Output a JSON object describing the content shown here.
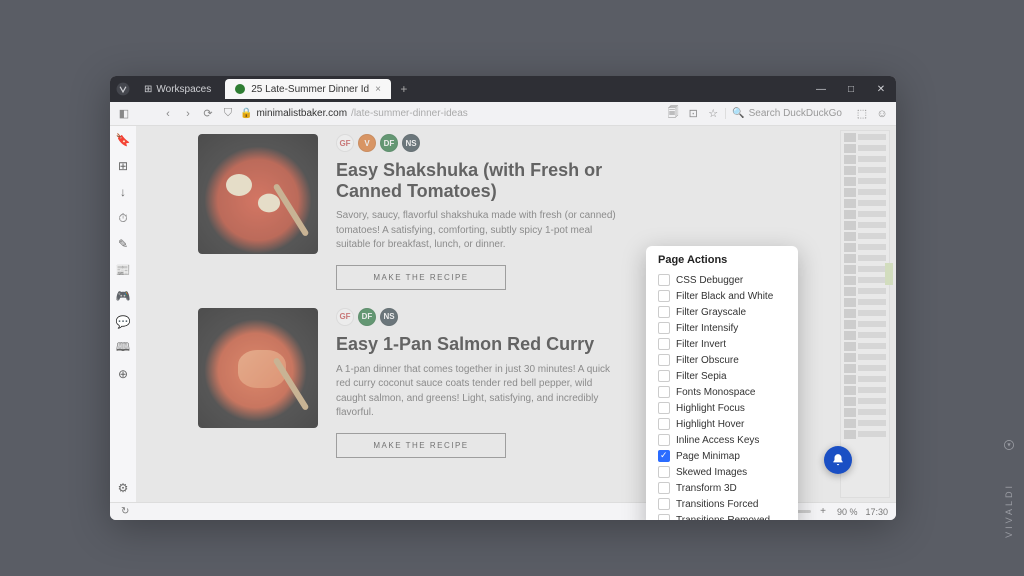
{
  "titlebar": {
    "workspaces_label": "Workspaces",
    "tab_title": "25 Late-Summer Dinner Id",
    "new_tab_glyph": "+",
    "minimize": "—",
    "maximize": "□",
    "close": "✕"
  },
  "addrbar": {
    "back": "‹",
    "forward": "›",
    "reload": "⟳",
    "lock": "🔒",
    "host": "minimalistbaker.com",
    "path": "/late-summer-dinner-ideas",
    "search_placeholder": "Search DuckDuckGo"
  },
  "panel_icons": [
    "🔖",
    "⊞",
    "↓",
    "⏱",
    "✎",
    "📰",
    "🎮",
    "💬",
    "🕮",
    "⊕"
  ],
  "recipes": [
    {
      "badges": [
        "GF",
        "V",
        "DF",
        "NS"
      ],
      "title": "Easy Shakshuka (with Fresh or Canned Tomatoes)",
      "desc": "Savory, saucy, flavorful shakshuka made with fresh (or canned) tomatoes! A satisfying, comforting, subtly spicy 1-pot meal suitable for breakfast, lunch, or dinner.",
      "cta": "MAKE THE RECIPE"
    },
    {
      "badges": [
        "GF",
        "DF",
        "NS"
      ],
      "title": "Easy 1-Pan Salmon Red Curry",
      "desc": "A 1-pan dinner that comes together in just 30 minutes! A quick red curry coconut sauce coats tender red bell pepper, wild caught salmon, and greens! Light, satisfying, and incredibly flavorful.",
      "cta": "MAKE THE RECIPE"
    }
  ],
  "popup": {
    "title": "Page Actions",
    "items": [
      {
        "label": "CSS Debugger",
        "checked": false
      },
      {
        "label": "Filter Black and White",
        "checked": false
      },
      {
        "label": "Filter Grayscale",
        "checked": false
      },
      {
        "label": "Filter Intensify",
        "checked": false
      },
      {
        "label": "Filter Invert",
        "checked": false
      },
      {
        "label": "Filter Obscure",
        "checked": false
      },
      {
        "label": "Filter Sepia",
        "checked": false
      },
      {
        "label": "Fonts Monospace",
        "checked": false
      },
      {
        "label": "Highlight Focus",
        "checked": false
      },
      {
        "label": "Highlight Hover",
        "checked": false
      },
      {
        "label": "Inline Access Keys",
        "checked": false
      },
      {
        "label": "Page Minimap",
        "checked": true
      },
      {
        "label": "Skewed Images",
        "checked": false
      },
      {
        "label": "Transform 3D",
        "checked": false
      },
      {
        "label": "Transitions Forced",
        "checked": false
      },
      {
        "label": "Transitions Removed",
        "checked": false
      }
    ]
  },
  "status": {
    "reset": "Reset",
    "zoom": "90 %",
    "clock": "17:30"
  },
  "watermark": "VIVALDI"
}
